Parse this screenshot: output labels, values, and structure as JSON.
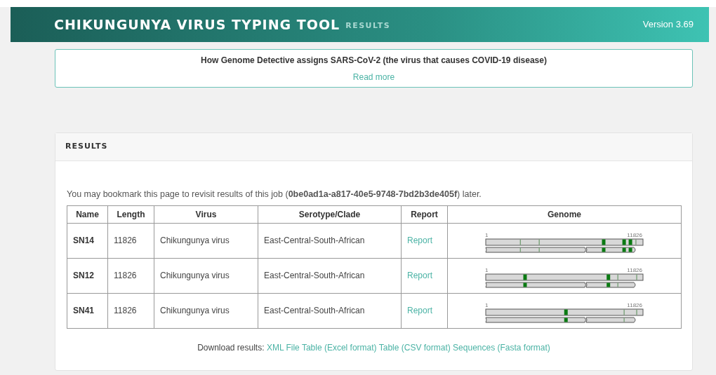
{
  "header": {
    "title": "CHIKUNGUNYA VIRUS TYPING TOOL",
    "subtitle": "RESULTS",
    "version": "Version 3.69"
  },
  "notice": {
    "text": "How Genome Detective assigns SARS-CoV-2 (the virus that causes COVID-19 disease)",
    "link": "Read more"
  },
  "results": {
    "heading": "RESULTS",
    "bookmark_text": "You may bookmark this page to revisit results of this job (**0be0ad1a-a817-40e5-9748-7bd2b3de405f**) later.",
    "table": {
      "columns": [
        "Name",
        "Length",
        "Virus",
        "Serotype/Clade",
        "Report",
        "Genome"
      ],
      "rows": [
        {
          "name": "SN14",
          "length": "11826",
          "virus": "Chikungunya virus",
          "clade": "East-Central-South-African",
          "report": "Report",
          "genome_start": "1",
          "genome_end": "11826"
        },
        {
          "name": "SN12",
          "length": "11826",
          "virus": "Chikungunya virus",
          "clade": "East-Central-South-African",
          "report": "Report",
          "genome_start": "1",
          "genome_end": "11826"
        },
        {
          "name": "SN41",
          "length": "11826",
          "virus": "Chikungunya virus",
          "clade": "East-Central-South-African",
          "report": "Report",
          "genome_start": "1",
          "genome_end": "11826"
        }
      ]
    },
    "download_label": "Download results:",
    "download_links": [
      "XML File",
      "Table (Excel format)",
      "Table (CSV format)",
      "Sequences (Fasta format)"
    ]
  }
}
